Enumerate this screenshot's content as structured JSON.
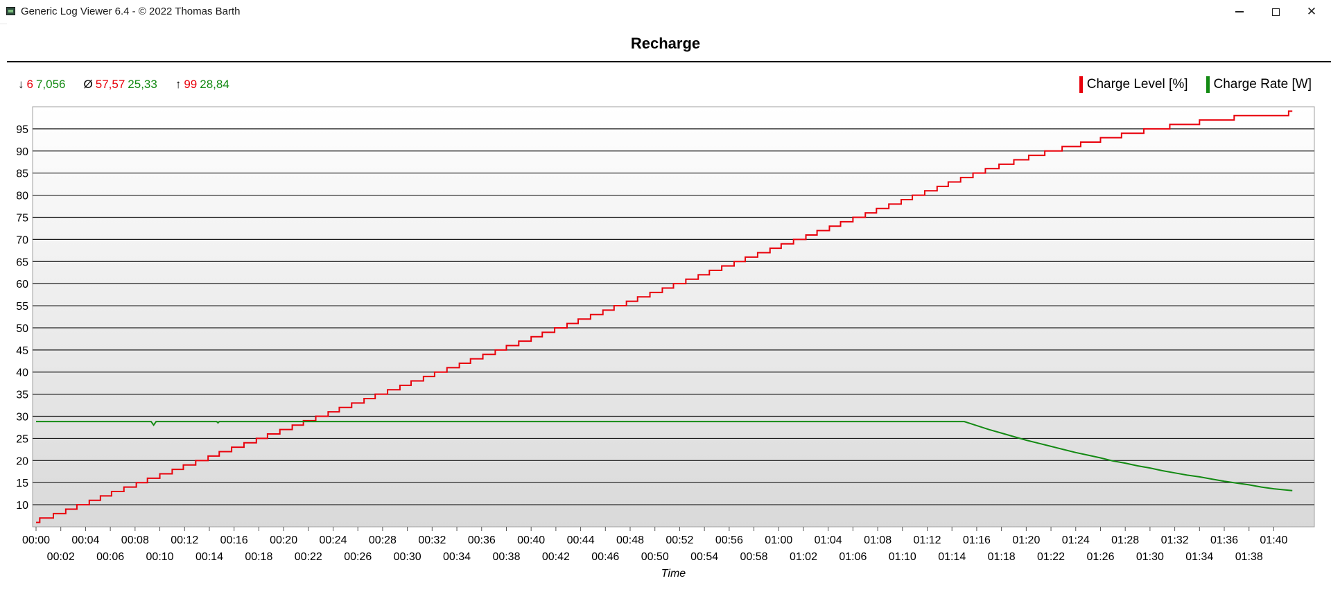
{
  "window": {
    "title": "Generic Log Viewer 6.4 - © 2022 Thomas Barth"
  },
  "stats": {
    "min_arrow": "↓",
    "min_level": "6",
    "min_rate": "7,056",
    "avg_symbol": "Ø",
    "avg_level": "57,57",
    "avg_rate": "25,33",
    "max_arrow": "↑",
    "max_level": "99",
    "max_rate": "28,84"
  },
  "chart_data": {
    "type": "line",
    "title": "Recharge",
    "xlabel": "Time",
    "ylabel": "",
    "x_unit": "minutes",
    "xlim": [
      0,
      103
    ],
    "ylim": [
      5,
      100
    ],
    "grid": true,
    "legend_position": "top-right",
    "y_ticks": [
      "10",
      "15",
      "20",
      "25",
      "30",
      "35",
      "40",
      "45",
      "50",
      "55",
      "60",
      "65",
      "70",
      "75",
      "80",
      "85",
      "90",
      "95"
    ],
    "x_ticks": [
      "00:00",
      "00:02",
      "00:04",
      "00:06",
      "00:08",
      "00:10",
      "00:12",
      "00:14",
      "00:16",
      "00:18",
      "00:20",
      "00:22",
      "00:24",
      "00:26",
      "00:28",
      "00:30",
      "00:32",
      "00:34",
      "00:36",
      "00:38",
      "00:40",
      "00:42",
      "00:44",
      "00:46",
      "00:48",
      "00:50",
      "00:52",
      "00:54",
      "00:56",
      "00:58",
      "01:00",
      "01:02",
      "01:04",
      "01:06",
      "01:08",
      "01:10",
      "01:12",
      "01:14",
      "01:16",
      "01:18",
      "01:20",
      "01:22",
      "01:24",
      "01:26",
      "01:28",
      "01:30",
      "01:32",
      "01:34",
      "01:36",
      "01:38",
      "01:40"
    ],
    "series": [
      {
        "name": "Charge Level [%]",
        "color": "#e8000b",
        "step": true,
        "points": [
          [
            0,
            6
          ],
          [
            0.3,
            7
          ],
          [
            1.4,
            8
          ],
          [
            2.4,
            9
          ],
          [
            3.3,
            10
          ],
          [
            4.3,
            11
          ],
          [
            5.2,
            12
          ],
          [
            6.1,
            13
          ],
          [
            7.1,
            14
          ],
          [
            8.1,
            15
          ],
          [
            9,
            16
          ],
          [
            10,
            17
          ],
          [
            11,
            18
          ],
          [
            11.9,
            19
          ],
          [
            12.9,
            20
          ],
          [
            13.9,
            21
          ],
          [
            14.8,
            22
          ],
          [
            15.8,
            23
          ],
          [
            16.8,
            24
          ],
          [
            17.8,
            25
          ],
          [
            18.7,
            26
          ],
          [
            19.7,
            27
          ],
          [
            20.7,
            28
          ],
          [
            21.6,
            29
          ],
          [
            22.6,
            30
          ],
          [
            23.6,
            31
          ],
          [
            24.5,
            32
          ],
          [
            25.5,
            33
          ],
          [
            26.5,
            34
          ],
          [
            27.4,
            35
          ],
          [
            28.4,
            36
          ],
          [
            29.4,
            37
          ],
          [
            30.3,
            38
          ],
          [
            31.3,
            39
          ],
          [
            32.2,
            40
          ],
          [
            33.2,
            41
          ],
          [
            34.2,
            42
          ],
          [
            35.1,
            43
          ],
          [
            36.1,
            44
          ],
          [
            37.1,
            45
          ],
          [
            38,
            46
          ],
          [
            39,
            47
          ],
          [
            40,
            48
          ],
          [
            40.9,
            49
          ],
          [
            41.9,
            50
          ],
          [
            42.9,
            51
          ],
          [
            43.8,
            52
          ],
          [
            44.8,
            53
          ],
          [
            45.8,
            54
          ],
          [
            46.7,
            55
          ],
          [
            47.7,
            56
          ],
          [
            48.6,
            57
          ],
          [
            49.6,
            58
          ],
          [
            50.6,
            59
          ],
          [
            51.5,
            60
          ],
          [
            52.5,
            61
          ],
          [
            53.5,
            62
          ],
          [
            54.4,
            63
          ],
          [
            55.4,
            64
          ],
          [
            56.4,
            65
          ],
          [
            57.3,
            66
          ],
          [
            58.3,
            67
          ],
          [
            59.3,
            68
          ],
          [
            60.2,
            69
          ],
          [
            61.2,
            70
          ],
          [
            62.2,
            71
          ],
          [
            63.1,
            72
          ],
          [
            64.1,
            73
          ],
          [
            65,
            74
          ],
          [
            66,
            75
          ],
          [
            67,
            76
          ],
          [
            67.9,
            77
          ],
          [
            68.9,
            78
          ],
          [
            69.9,
            79
          ],
          [
            70.8,
            80
          ],
          [
            71.8,
            81
          ],
          [
            72.8,
            82
          ],
          [
            73.7,
            83
          ],
          [
            74.7,
            84
          ],
          [
            75.7,
            85
          ],
          [
            76.7,
            86
          ],
          [
            77.8,
            87
          ],
          [
            79,
            88
          ],
          [
            80.2,
            89
          ],
          [
            81.5,
            90
          ],
          [
            82.9,
            91
          ],
          [
            84.4,
            92
          ],
          [
            86,
            93
          ],
          [
            87.7,
            94
          ],
          [
            89.5,
            95
          ],
          [
            91.6,
            96
          ],
          [
            94,
            97
          ],
          [
            96.8,
            98
          ],
          [
            101.2,
            99
          ],
          [
            101.5,
            99
          ]
        ],
        "end_x": 101.5
      },
      {
        "name": "Charge Rate [W]",
        "color": "#138a13",
        "step": false,
        "points": [
          [
            0,
            28.8
          ],
          [
            9.3,
            28.8
          ],
          [
            9.5,
            28.0
          ],
          [
            9.7,
            28.8
          ],
          [
            14.6,
            28.8
          ],
          [
            14.7,
            28.5
          ],
          [
            14.8,
            28.8
          ],
          [
            75.0,
            28.8
          ],
          [
            76,
            27.9
          ],
          [
            77,
            27.0
          ],
          [
            78,
            26.2
          ],
          [
            79,
            25.4
          ],
          [
            80,
            24.6
          ],
          [
            81,
            23.9
          ],
          [
            82,
            23.2
          ],
          [
            83,
            22.5
          ],
          [
            84,
            21.8
          ],
          [
            85,
            21.2
          ],
          [
            86,
            20.6
          ],
          [
            87,
            19.9
          ],
          [
            88,
            19.4
          ],
          [
            89,
            18.8
          ],
          [
            90,
            18.3
          ],
          [
            91,
            17.7
          ],
          [
            92,
            17.2
          ],
          [
            93,
            16.7
          ],
          [
            94,
            16.3
          ],
          [
            95,
            15.8
          ],
          [
            96,
            15.3
          ],
          [
            97,
            14.9
          ],
          [
            98,
            14.5
          ],
          [
            99,
            14.0
          ],
          [
            100,
            13.6
          ],
          [
            101.5,
            13.2
          ]
        ]
      }
    ]
  }
}
